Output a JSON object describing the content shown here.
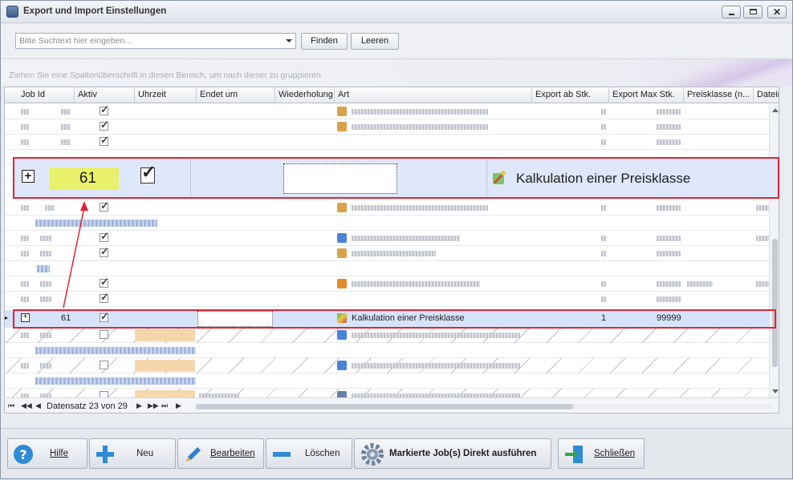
{
  "window": {
    "title": "Export und Import Einstellungen"
  },
  "search": {
    "placeholder": "Bitte Suchtext hier eingeben...",
    "find_label": "Finden",
    "clear_label": "Leeren"
  },
  "group_hint": "Ziehen Sie eine Spaltenüberschrift in diesen Bereich, um nach dieser zu gruppieren",
  "columns": [
    "Job Id",
    "Aktiv",
    "Uhrzeit",
    "Endet um",
    "Wiederholung",
    "Art",
    "Export ab Stk.",
    "Export Max Stk.",
    "Preisklasse (n...",
    "Dateinar"
  ],
  "selected_row": {
    "expand": "⊞",
    "job_id": "61",
    "aktiv": true,
    "art": "Kalkulation einer Preisklasse",
    "export_ab": "1",
    "export_max": "99999"
  },
  "zoom": {
    "job_id": "61",
    "art": "Kalkulation einer Preisklasse"
  },
  "navigator": {
    "record_text": "Datensatz 23 von 29"
  },
  "footer": {
    "help": "Hilfe",
    "new": "Neu",
    "edit": "Bearbeiten",
    "delete": "Löschen",
    "run": "Markierte Job(s) Direkt ausführen",
    "close": "Schließen"
  },
  "colors": {
    "highlight": "#e32335",
    "selection": "#d7e3fb",
    "zoom_id": "#e9f06b"
  }
}
